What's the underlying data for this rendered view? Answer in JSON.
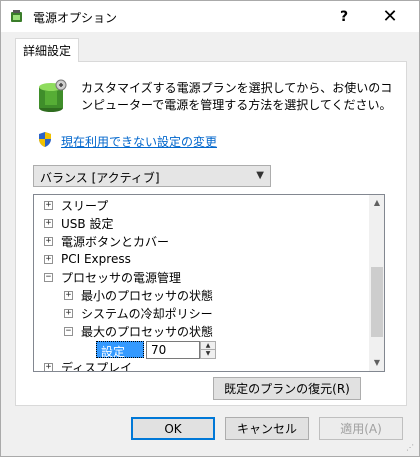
{
  "window": {
    "title": "電源オプション",
    "help_label": "?",
    "close_label": "✕"
  },
  "tab": {
    "label": "詳細設定"
  },
  "description": "カスタマイズする電源プランを選択してから、お使いのコンピューターで電源を管理する方法を選択してください。",
  "link": {
    "label": "現在利用できない設定の変更"
  },
  "plan_select": {
    "value": "バランス [アクティブ]"
  },
  "tree": {
    "items": [
      {
        "label": "スリープ",
        "expander": "+"
      },
      {
        "label": "USB 設定",
        "expander": "+"
      },
      {
        "label": "電源ボタンとカバー",
        "expander": "+"
      },
      {
        "label": "PCI Express",
        "expander": "+"
      },
      {
        "label": "プロセッサの電源管理",
        "expander": "−"
      },
      {
        "label": "最小のプロセッサの状態",
        "expander": "+"
      },
      {
        "label": "システムの冷却ポリシー",
        "expander": "+"
      },
      {
        "label": "最大のプロセッサの状態",
        "expander": "−"
      },
      {
        "label": "ディスプレイ",
        "expander": "+"
      }
    ],
    "setting_label": "設定 (%):",
    "setting_value": "70"
  },
  "buttons": {
    "restore": "既定のプランの復元(R)",
    "ok": "OK",
    "cancel": "キャンセル",
    "apply": "適用(A)"
  },
  "colors": {
    "link": "#0066cc",
    "selection": "#3399ff",
    "ok_border": "#0078d7"
  }
}
